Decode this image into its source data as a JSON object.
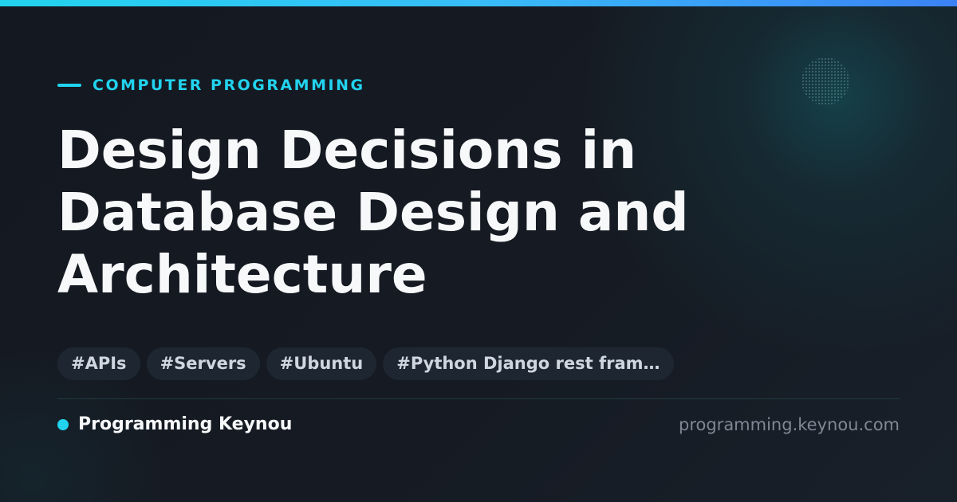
{
  "colors": {
    "accent": "#22d3ee",
    "accent_gradient_end": "#3b82f6",
    "background": "#151a22",
    "title": "#f7f8fa",
    "tag_background": "#1e2731",
    "tag_text": "#cfd6df",
    "url_text": "#7f8894"
  },
  "category": {
    "label": "COMPUTER PROGRAMMING"
  },
  "article": {
    "title": "Design Decisions in Database Design and Architecture"
  },
  "tags": [
    "#APIs",
    "#Servers",
    "#Ubuntu",
    "#Python Django rest fram…"
  ],
  "footer": {
    "brand_name": "Programming Keynou",
    "site_url": "programming.keynou.com"
  },
  "icons": {
    "brand_marker": "dot-icon",
    "category_marker": "dash-icon"
  }
}
